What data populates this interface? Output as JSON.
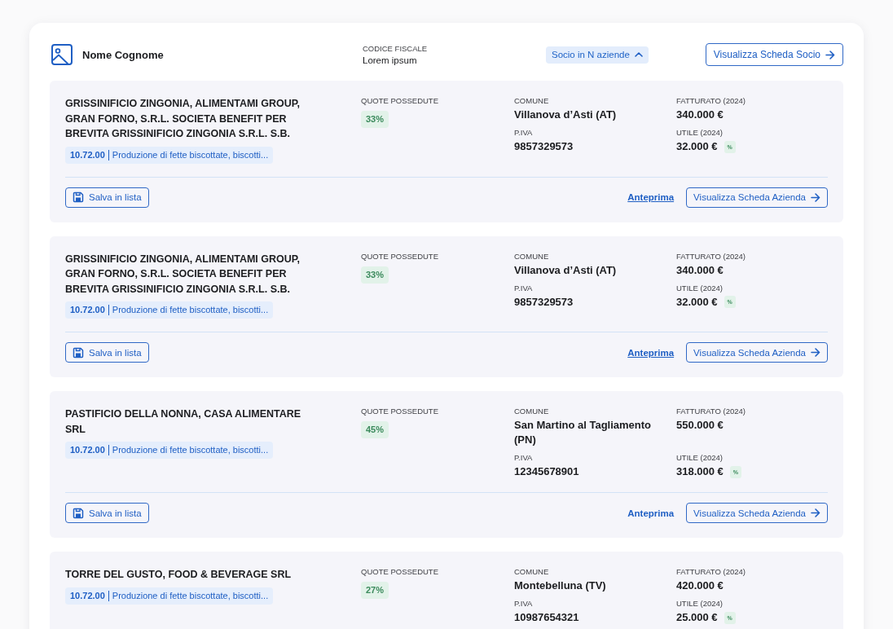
{
  "profile": {
    "name": "Nome Cognome",
    "codice_fiscale_label": "CODICE FISCALE",
    "codice_fiscale": "Lorem ipsum",
    "socio_toggle": {
      "label": "Socio in N aziende",
      "expanded": true
    },
    "view_button": "Visualizza Scheda Socio"
  },
  "companies": [
    {
      "name": "GRISSINIFICIO ZINGONIA, ALIMENTAMI GROUP, GRAN FORNO, S.R.L. SOCIETA BENEFIT PER BREVITA GRISSINIFICIO ZINGONIA S.R.L. S.B.",
      "ateco_code": "10.72.00",
      "ateco_description": "Produzione di fette biscottate, biscotti...",
      "quote_label": "QUOTE POSSEDUTE",
      "quote": "33%",
      "comune_label": "COMUNE",
      "comune": "Villanova d’Asti (AT)",
      "piva_label": "P.IVA",
      "piva": "9857329573",
      "fatturato_label": "FATTURATO (2024)",
      "fatturato": "340.000 €",
      "utile_label": "UTILE (2024)",
      "utile": "32.000 €",
      "utile_badge": "%",
      "save_button": "Salva in lista",
      "preview_link": {
        "label": "Anteprima",
        "underlined": true
      },
      "view_button": "Visualizza Scheda Azienda"
    },
    {
      "name": "GRISSINIFICIO ZINGONIA, ALIMENTAMI GROUP, GRAN FORNO, S.R.L. SOCIETA BENEFIT PER BREVITA GRISSINIFICIO ZINGONIA S.R.L. S.B.",
      "ateco_code": "10.72.00",
      "ateco_description": "Produzione di fette biscottate, biscotti...",
      "quote_label": "QUOTE POSSEDUTE",
      "quote": "33%",
      "comune_label": "COMUNE",
      "comune": "Villanova d’Asti (AT)",
      "piva_label": "P.IVA",
      "piva": "9857329573",
      "fatturato_label": "FATTURATO (2024)",
      "fatturato": "340.000 €",
      "utile_label": "UTILE (2024)",
      "utile": "32.000 €",
      "utile_badge": "%",
      "save_button": "Salva in lista",
      "preview_link": {
        "label": "Anteprima",
        "underlined": true
      },
      "view_button": "Visualizza Scheda Azienda"
    },
    {
      "name": "PASTIFICIO DELLA NONNA, CASA ALIMENTARE SRL",
      "ateco_code": "10.72.00",
      "ateco_description": "Produzione di fette biscottate, biscotti...",
      "quote_label": "QUOTE POSSEDUTE",
      "quote": "45%",
      "comune_label": "COMUNE",
      "comune": "San Martino al Tagliamento (PN)",
      "piva_label": "P.IVA",
      "piva": "12345678901",
      "fatturato_label": "FATTURATO (2024)",
      "fatturato": "550.000 €",
      "utile_label": "UTILE (2024)",
      "utile": "318.000 €",
      "utile_badge": "%",
      "save_button": "Salva in lista",
      "preview_link": {
        "label": "Anteprima",
        "underlined": false
      },
      "view_button": "Visualizza Scheda Azienda"
    },
    {
      "name": "TORRE DEL GUSTO, FOOD & BEVERAGE SRL",
      "ateco_code": "10.72.00",
      "ateco_description": "Produzione di fette biscottate, biscotti...",
      "quote_label": "QUOTE POSSEDUTE",
      "quote": "27%",
      "comune_label": "COMUNE",
      "comune": "Montebelluna (TV)",
      "piva_label": "P.IVA",
      "piva": "10987654321",
      "fatturato_label": "FATTURATO (2024)",
      "fatturato": "420.000 €",
      "utile_label": "UTILE (2024)",
      "utile": "25.000 €",
      "utile_badge": "%"
    }
  ]
}
